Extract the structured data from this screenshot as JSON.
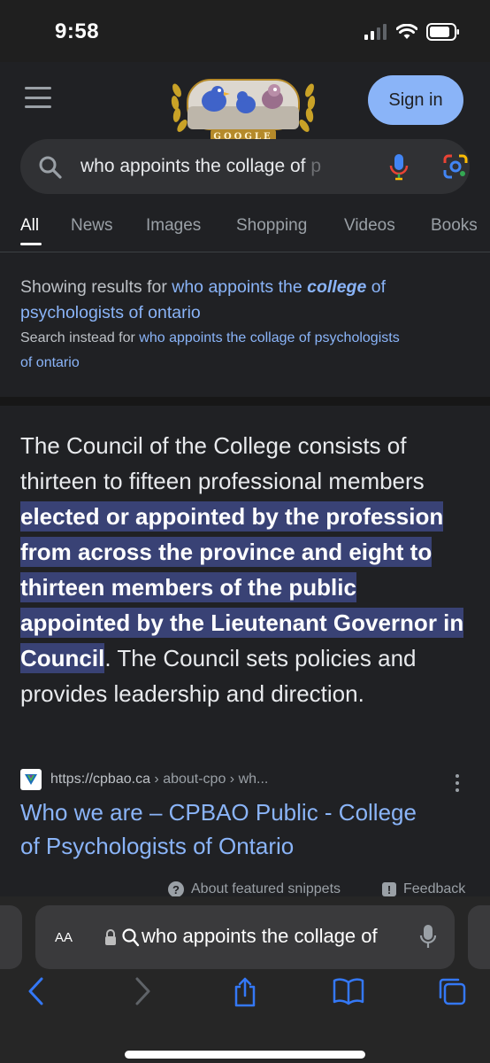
{
  "status_bar": {
    "time": "9:58"
  },
  "header": {
    "sign_in_label": "Sign in",
    "doodle_text": "GOOGLE"
  },
  "search": {
    "query_visible": "who appoints the collage of ",
    "query_fade": "p"
  },
  "tabs": [
    {
      "label": "All",
      "active": true
    },
    {
      "label": "News",
      "active": false
    },
    {
      "label": "Images",
      "active": false
    },
    {
      "label": "Shopping",
      "active": false
    },
    {
      "label": "Videos",
      "active": false
    },
    {
      "label": "Books",
      "active": false
    }
  ],
  "correction": {
    "showing_prefix": "Showing results for ",
    "corrected_part1": "who appoints the ",
    "corrected_bold": "college",
    "corrected_part2": " of",
    "corrected_part3": "psychologists of ontario",
    "instead_prefix": "Search instead for ",
    "instead_link_line1": "who appoints the collage of psychologists",
    "instead_link_line2": "of ontario"
  },
  "snippet": {
    "text_before": "The Council of the College consists of thirteen to fifteen professional members ",
    "highlight_lines": [
      "elected or appointed by the",
      "profession from across the province",
      "and eight to thirteen members of the",
      "public appointed by the Lieutenant",
      "Governor in Council"
    ],
    "text_after": ". The Council sets policies and provides leadership and direction."
  },
  "source": {
    "url": "https://cpbao.ca",
    "breadcrumb": " › about-cpo › wh...",
    "title_line1": "Who we are – CPBAO Public - College",
    "title_line2": "of Psychologists of Ontario"
  },
  "footer_links": {
    "about_snippets": "About featured snippets",
    "feedback": "Feedback"
  },
  "safari": {
    "aa_label": "AA",
    "address_text": "who appoints the collage of"
  },
  "colors": {
    "background": "#202124",
    "link": "#8ab4f8",
    "highlight": "#394275",
    "sign_in_bg": "#8ab4f8",
    "safari_accent": "#3478f6"
  }
}
